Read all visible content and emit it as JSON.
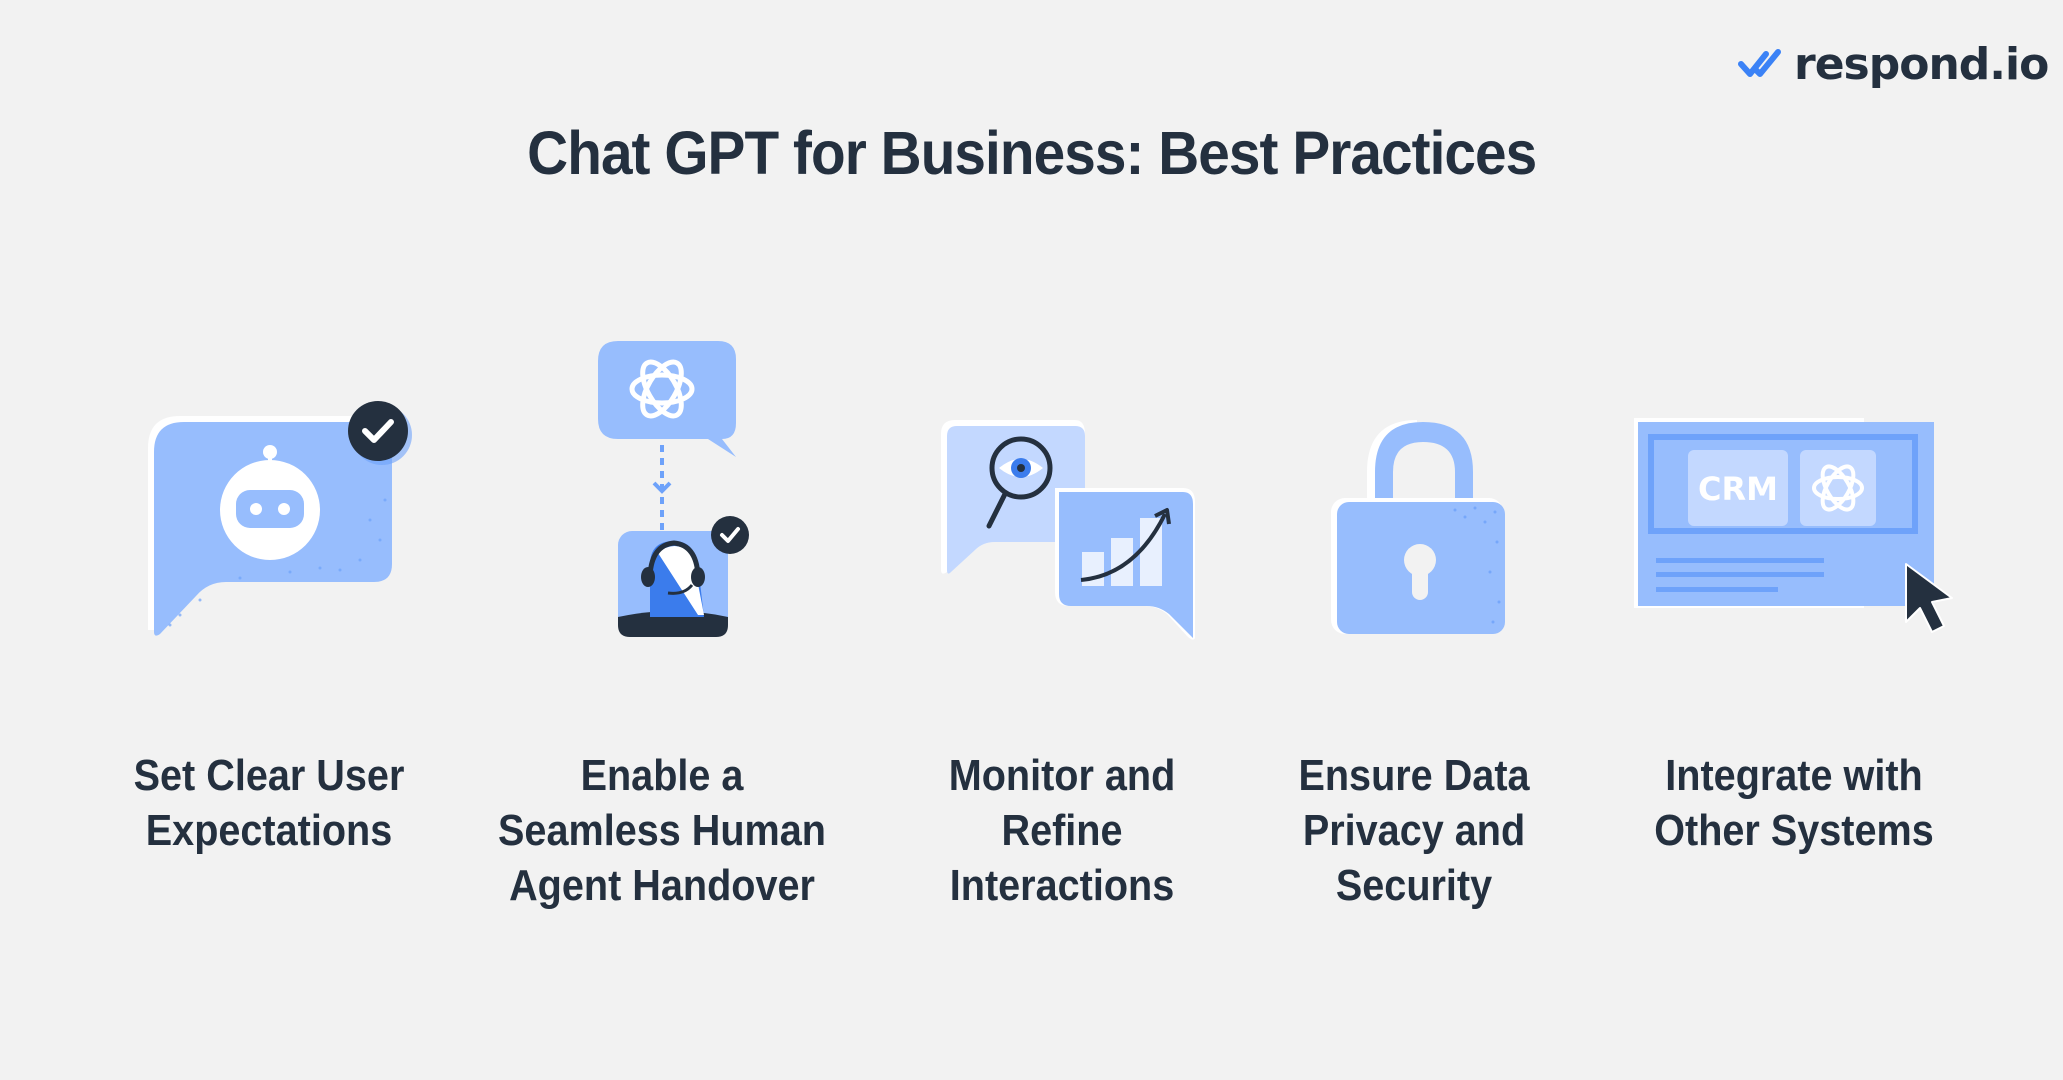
{
  "brand": {
    "name": "respond.io",
    "logo_icon": "double-check-icon",
    "accent_color": "#3b82f6"
  },
  "title": "Chat GPT for Business: Best Practices",
  "colors": {
    "background": "#f2f2f2",
    "text": "#24303f",
    "icon_fill": "#97bdfd",
    "icon_light": "#c3d8ff",
    "icon_dark": "#6ea2fa",
    "badge": "#24303f"
  },
  "practices": [
    {
      "icon": "robot-chat-bubble-icon",
      "lines": [
        "Set Clear User",
        "Expectations"
      ]
    },
    {
      "icon": "chatgpt-to-human-agent-icon",
      "lines": [
        "Enable a",
        "Seamless Human",
        "Agent Handover"
      ]
    },
    {
      "icon": "monitor-analytics-icon",
      "lines": [
        "Monitor and",
        "Refine",
        "Interactions"
      ]
    },
    {
      "icon": "padlock-icon",
      "lines": [
        "Ensure Data",
        "Privacy and",
        "Security"
      ]
    },
    {
      "icon": "crm-integration-icon",
      "lines": [
        "Integrate with",
        "Other Systems"
      ],
      "crm_label": "CRM"
    }
  ]
}
